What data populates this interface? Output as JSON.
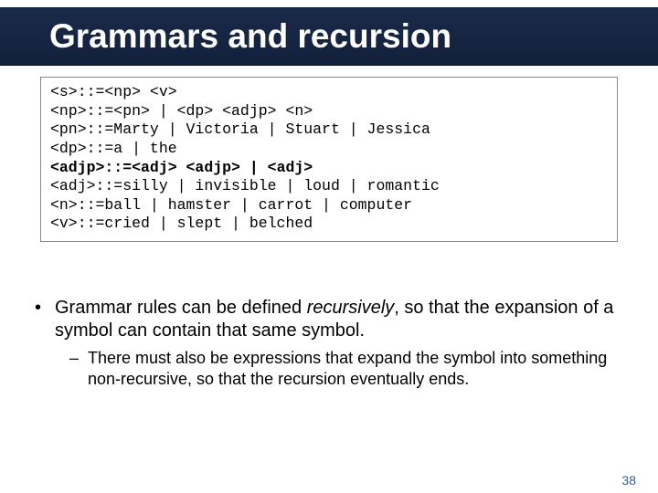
{
  "title": "Grammars and recursion",
  "grammar": {
    "l1": "<s>::=<np> <v>",
    "l2": "<np>::=<pn> | <dp> <adjp> <n>",
    "l3": "<pn>::=Marty | Victoria | Stuart | Jessica",
    "l4": "<dp>::=a | the",
    "l5a": "<adjp>::=<adj> ",
    "l5b": "<adjp>",
    "l5c": " | ",
    "l5d": "<adj>",
    "l6": "<adj>::=silly | invisible | loud | romantic",
    "l7": "<n>::=ball | hamster | carrot | computer",
    "l8": "<v>::=cried | slept | belched"
  },
  "bullet": {
    "pre": "Grammar rules can be defined ",
    "ital": "recursively",
    "post": ", so that the expansion of a symbol can contain that same symbol."
  },
  "subbullet": "There must also be expressions that expand the symbol into something non-recursive, so that the recursion eventually ends.",
  "page_num": "38"
}
